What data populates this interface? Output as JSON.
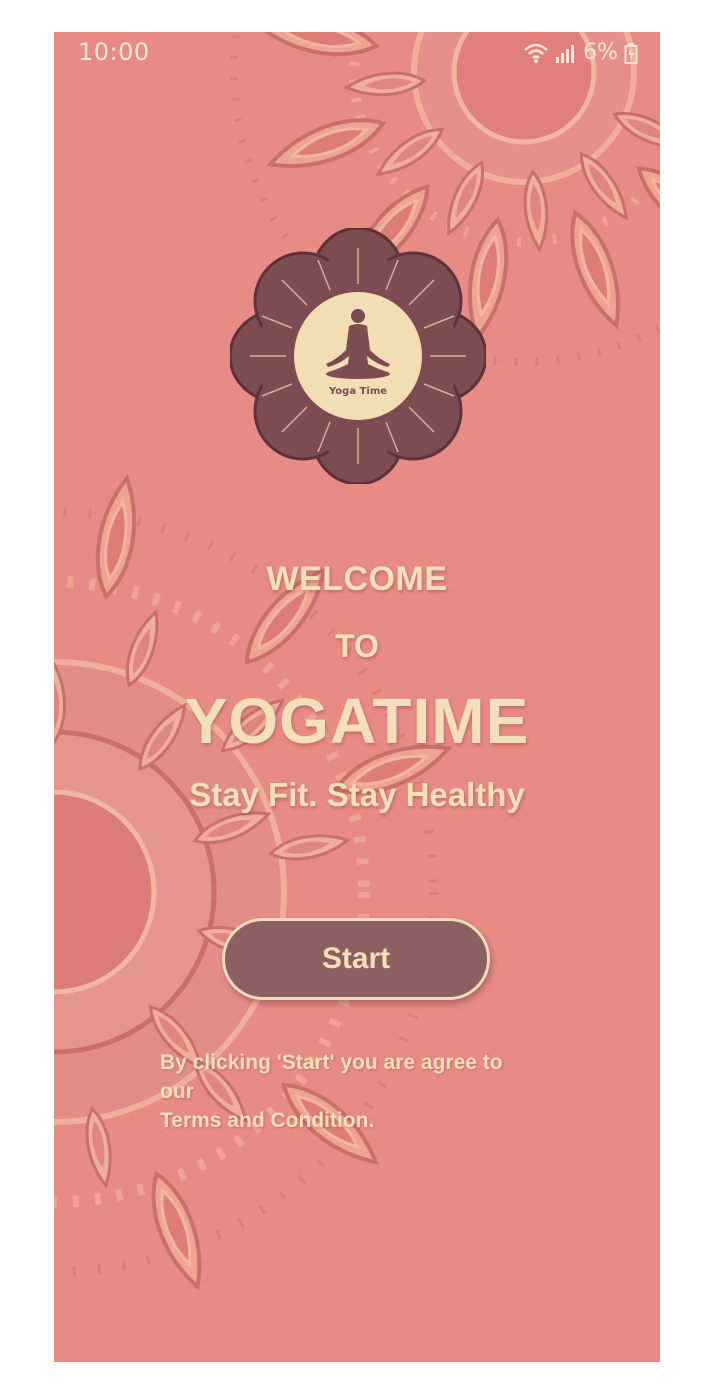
{
  "status_bar": {
    "time": "10:00",
    "battery": "6%",
    "icons": [
      "wifi-icon",
      "signal-icon",
      "battery-icon"
    ]
  },
  "logo": {
    "text": "Yoga Time",
    "icon": "meditation-figure-icon"
  },
  "welcome": {
    "line1": "WELCOME",
    "line2": "TO",
    "brand": "YOGATIME",
    "tagline": "Stay Fit. Stay Healthy"
  },
  "start_button": {
    "label": "Start"
  },
  "terms": {
    "line1": "By clicking 'Start' you are agree to our",
    "line2": "Terms and Condition."
  },
  "colors": {
    "background": "#e88a86",
    "text": "#f3dfb8",
    "button": "#8c5f62",
    "logo_dark": "#7d4c53",
    "logo_light": "#f2ddb5"
  }
}
